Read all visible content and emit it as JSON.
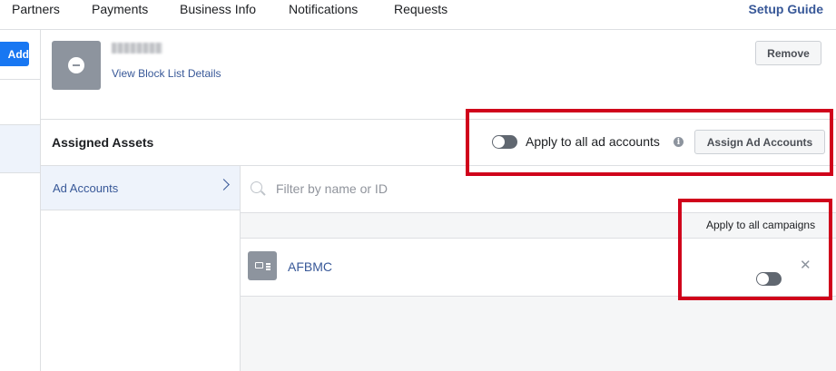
{
  "nav": {
    "items": [
      "Partners",
      "Payments",
      "Business Info",
      "Notifications",
      "Requests"
    ],
    "setup_guide": "Setup Guide"
  },
  "left": {
    "add_label": "Add"
  },
  "block_list": {
    "view_link": "View Block List Details",
    "remove_label": "Remove",
    "icon": "block-icon"
  },
  "assigned": {
    "title": "Assigned Assets",
    "apply_all_accounts_label": "Apply to all ad accounts",
    "apply_all_accounts_on": false,
    "assign_button": "Assign Ad Accounts"
  },
  "categories": {
    "ad_accounts": "Ad Accounts"
  },
  "search": {
    "placeholder": "Filter by name or ID"
  },
  "table": {
    "header_apply_campaigns": "Apply to all campaigns",
    "rows": [
      {
        "name": "AFBMC",
        "apply_all_campaigns_on": false,
        "icon": "ad-account-icon"
      }
    ]
  },
  "colors": {
    "accent": "#1877f2",
    "link": "#385898",
    "highlight": "#d0021b"
  }
}
